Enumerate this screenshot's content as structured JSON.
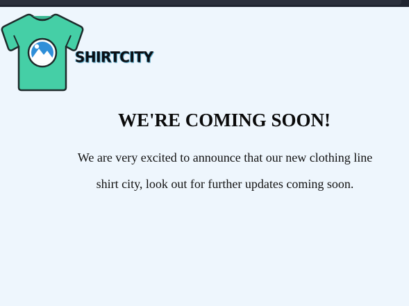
{
  "brand": {
    "name": "SHIRTCITY",
    "logo_icon": "tshirt-image-icon",
    "shirt_color": "#45cfa6",
    "accent_color": "#2f8fd8"
  },
  "announcement": {
    "headline": "WE'RE COMING SOON!",
    "message": "We are very excited to announce that our new clothing line shirt city, look out for further updates coming soon."
  },
  "colors": {
    "page_background": "#eef6fd",
    "top_bar": "#1f2430",
    "text": "#0a0a0a"
  }
}
